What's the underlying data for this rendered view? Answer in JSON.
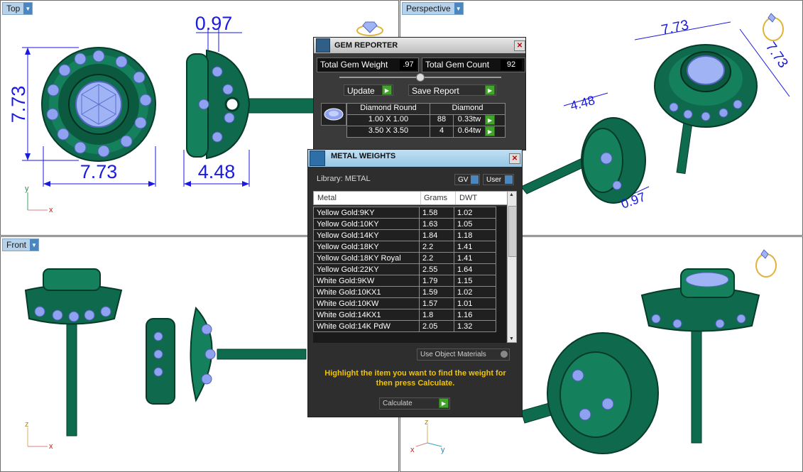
{
  "viewports": {
    "top": {
      "label": "Top"
    },
    "perspective": {
      "label": "Perspective"
    },
    "front": {
      "label": "Front"
    }
  },
  "dimensions": {
    "top_height": "7.73",
    "top_width": "7.73",
    "side_top": "0.97",
    "side_width": "4.48",
    "persp_a": "7.73",
    "persp_b": "7.73",
    "persp_c": "4.48",
    "persp_d": "0.97"
  },
  "axes": {
    "x": "x",
    "y": "y",
    "z": "z"
  },
  "gem_reporter": {
    "title": "GEM REPORTER",
    "total_weight_label": "Total Gem Weight",
    "total_weight_value": ".97",
    "total_count_label": "Total Gem Count",
    "total_count_value": "92",
    "update_label": "Update",
    "save_report_label": "Save Report",
    "header_shape": "Diamond Round",
    "header_type": "Diamond",
    "rows": [
      {
        "size": "1.00 X 1.00",
        "count": "88",
        "weight": "0.33tw"
      },
      {
        "size": "3.50 X 3.50",
        "count": "4",
        "weight": "0.64tw"
      }
    ]
  },
  "metal_weights": {
    "title": "METAL WEIGHTS",
    "library_label": "Library: METAL",
    "gv_label": "GV",
    "user_label": "User",
    "columns": [
      "Metal",
      "Grams",
      "DWT"
    ],
    "rows": [
      {
        "metal": "Yellow Gold:9KY",
        "grams": "1.58",
        "dwt": "1.02"
      },
      {
        "metal": "Yellow Gold:10KY",
        "grams": "1.63",
        "dwt": "1.05"
      },
      {
        "metal": "Yellow Gold:14KY",
        "grams": "1.84",
        "dwt": "1.18"
      },
      {
        "metal": "Yellow Gold:18KY",
        "grams": "2.2",
        "dwt": "1.41"
      },
      {
        "metal": "Yellow Gold:18KY Royal",
        "grams": "2.2",
        "dwt": "1.41"
      },
      {
        "metal": "Yellow Gold:22KY",
        "grams": "2.55",
        "dwt": "1.64"
      },
      {
        "metal": "White Gold:9KW",
        "grams": "1.79",
        "dwt": "1.15"
      },
      {
        "metal": "White Gold:10KX1",
        "grams": "1.59",
        "dwt": "1.02"
      },
      {
        "metal": "White Gold:10KW",
        "grams": "1.57",
        "dwt": "1.01"
      },
      {
        "metal": "White Gold:14KX1",
        "grams": "1.8",
        "dwt": "1.16"
      },
      {
        "metal": "White Gold:14K PdW",
        "grams": "2.05",
        "dwt": "1.32"
      }
    ],
    "use_object_materials_label": "Use Object Materials",
    "instruction": "Highlight the item you want to find the weight for then press Calculate.",
    "calculate_label": "Calculate"
  },
  "colors": {
    "metal": "#0e6b4e",
    "gem": "#8ea2f0",
    "dimension": "#1a1ae0",
    "instruction": "#f2c400",
    "go_button": "#43a42c"
  }
}
